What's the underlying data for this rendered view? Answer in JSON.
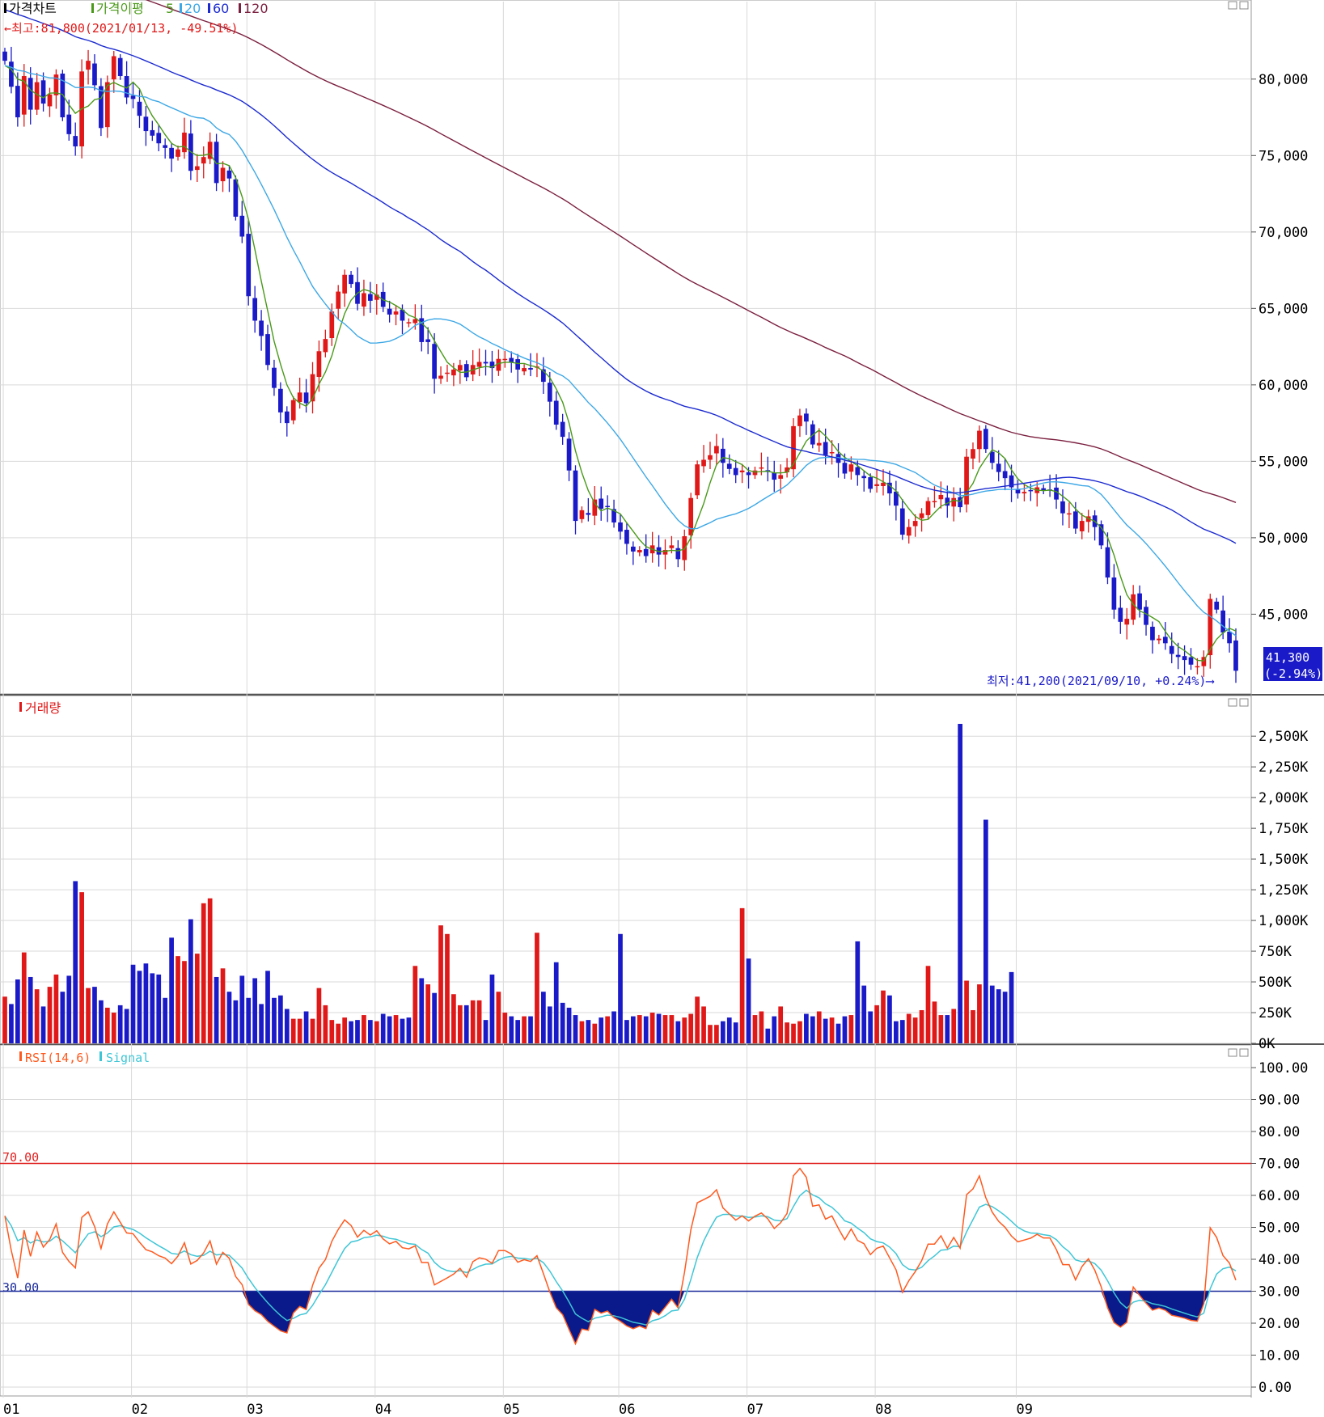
{
  "price_panel": {
    "legend": {
      "main": "가격차트",
      "ma_prefix": "가격이평",
      "ma_periods": [
        "5",
        "20",
        "60",
        "120"
      ],
      "colors": {
        "main": "#000000",
        "ma5": "#4a9a1a",
        "ma20": "#3da8e6",
        "ma60": "#1c2bd0",
        "ma120": "#7b1f3f"
      }
    },
    "high_note": "←최고:81,800(2021/01/13, -49.51%)",
    "low_note": "최저:41,200(2021/09/10, +0.24%)⟶",
    "last_price": "41,300",
    "last_change": "(-2.94%)",
    "y_ticks": [
      "80,000",
      "75,000",
      "70,000",
      "65,000",
      "60,000",
      "55,000",
      "50,000",
      "45,000"
    ]
  },
  "volume_panel": {
    "legend": "거래량",
    "y_ticks": [
      "2,500K",
      "2,250K",
      "2,000K",
      "1,750K",
      "1,500K",
      "1,250K",
      "1,000K",
      "750K",
      "500K",
      "250K",
      "0K"
    ]
  },
  "rsi_panel": {
    "legend_rsi": "RSI(14,6)",
    "legend_signal": "Signal",
    "level_high": "70.00",
    "level_low": "30.00",
    "y_ticks": [
      "100.00",
      "90.00",
      "80.00",
      "70.00",
      "60.00",
      "50.00",
      "40.00",
      "30.00",
      "20.00",
      "10.00",
      "0.00"
    ]
  },
  "x_ticks": [
    "01",
    "02",
    "03",
    "04",
    "05",
    "06",
    "07",
    "08",
    "09"
  ],
  "colors": {
    "up": "#e01818",
    "down": "#1a1ac8",
    "grid": "#d9d9d9",
    "rsi": "#ff5a1f",
    "signal": "#3fc6d6",
    "rsi_high": "#e02020",
    "rsi_low": "#1a2a9a",
    "oversold_fill": "#0a1a8a",
    "last_box": "#1a1ac8"
  },
  "chart_data": [
    {
      "type": "candlestick",
      "title": "가격차트",
      "x_range": [
        "2021/01",
        "2021/09/10"
      ],
      "ylim": [
        41200,
        81800
      ],
      "high": {
        "value": 81800,
        "date": "2021/01/13",
        "change_pct": -49.51
      },
      "low": {
        "value": 41200,
        "date": "2021/09/10",
        "change_pct": 0.24
      },
      "last": {
        "value": 41300,
        "change_pct": -2.94
      },
      "close": [
        81200,
        79500,
        77500,
        80200,
        78000,
        79800,
        78400,
        79000,
        80300,
        77500,
        76400,
        75600,
        80500,
        81200,
        79600,
        76800,
        79800,
        81500,
        80200,
        78800,
        78700,
        77600,
        76600,
        76300,
        75800,
        75500,
        74800,
        75400,
        76500,
        74000,
        74300,
        74900,
        75900,
        73200,
        74200,
        73500,
        71000,
        69700,
        65800,
        64200,
        63200,
        61300,
        59800,
        58200,
        57500,
        59000,
        59500,
        58800,
        60700,
        62200,
        63000,
        64800,
        66100,
        67200,
        66600,
        65300,
        66000,
        65500,
        65900,
        65100,
        64600,
        64800,
        64200,
        64100,
        64300,
        62800,
        62800,
        60400,
        60600,
        60800,
        61000,
        61300,
        60500,
        61300,
        61500,
        61400,
        61100,
        61700,
        61700,
        61500,
        61000,
        61100,
        61000,
        61200,
        60200,
        58900,
        57400,
        56600,
        54400,
        51100,
        51800,
        51500,
        52500,
        51900,
        52000,
        51000,
        50400,
        49600,
        49100,
        49200,
        48800,
        49500,
        48900,
        49200,
        49500,
        48600,
        50100,
        52600,
        54800,
        55100,
        55400,
        56000,
        54900,
        54500,
        54100,
        54400,
        54100,
        54400,
        54600,
        54300,
        53800,
        54100,
        54600,
        57300,
        58000,
        57600,
        56100,
        56200,
        55400,
        55600,
        54900,
        54200,
        54800,
        54100,
        53900,
        53200,
        53500,
        53600,
        52900,
        52100,
        50200,
        50700,
        51100,
        51600,
        52400,
        52400,
        52800,
        52100,
        52600,
        52000,
        55300,
        55800,
        57000,
        55800,
        54900,
        54300,
        53900,
        53300,
        52900,
        53000,
        53100,
        53300,
        53100,
        53100,
        52500,
        51600,
        51600,
        50600,
        51100,
        51400,
        50700,
        49500,
        47400,
        45300,
        44500,
        44700,
        46300,
        45300,
        44300,
        43300,
        43400,
        43100,
        42400,
        42200,
        42000,
        41700,
        41600,
        42200,
        46000,
        45300,
        43800,
        43100,
        41300
      ],
      "ma_periods": [
        5,
        20,
        60,
        120
      ]
    },
    {
      "type": "bar",
      "title": "거래량",
      "unit": "K",
      "ylim": [
        0,
        2500
      ],
      "values": [
        380,
        320,
        520,
        740,
        540,
        440,
        300,
        460,
        560,
        420,
        550,
        1320,
        1230,
        450,
        460,
        350,
        290,
        250,
        310,
        280,
        640,
        590,
        650,
        570,
        560,
        370,
        860,
        710,
        670,
        1010,
        730,
        1140,
        1180,
        540,
        610,
        420,
        350,
        550,
        370,
        530,
        320,
        590,
        370,
        390,
        280,
        200,
        200,
        260,
        200,
        450,
        310,
        190,
        160,
        210,
        180,
        190,
        230,
        190,
        180,
        240,
        220,
        230,
        200,
        210,
        630,
        530,
        480,
        410,
        960,
        890,
        400,
        310,
        310,
        350,
        350,
        190,
        560,
        420,
        250,
        220,
        190,
        220,
        220,
        900,
        420,
        300,
        660,
        330,
        290,
        230,
        180,
        190,
        160,
        210,
        220,
        260,
        890,
        190,
        220,
        230,
        220,
        250,
        240,
        230,
        230,
        180,
        210,
        240,
        380,
        300,
        150,
        150,
        180,
        210,
        170,
        1100,
        690,
        230,
        260,
        120,
        220,
        300,
        170,
        160,
        180,
        240,
        220,
        260,
        200,
        210,
        160,
        220,
        230,
        830,
        470,
        260,
        310,
        430,
        390,
        180,
        190,
        240,
        210,
        270,
        630,
        340,
        230,
        230,
        280,
        2600,
        510,
        270,
        480,
        1820,
        470,
        440,
        420,
        580
      ],
      "note": "bar colors follow daily candle direction"
    },
    {
      "type": "line",
      "title": "RSI(14,6)",
      "ylim": [
        0,
        100
      ],
      "levels": [
        70,
        30
      ],
      "series": [
        {
          "name": "RSI(14,6)"
        },
        {
          "name": "Signal"
        }
      ]
    }
  ]
}
